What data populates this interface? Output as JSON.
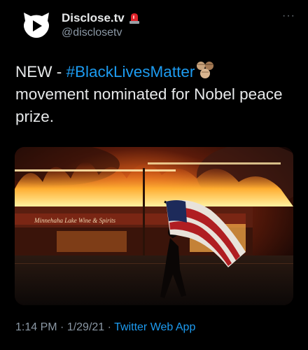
{
  "account": {
    "display_name": "Disclose.tv",
    "handle": "@disclosetv",
    "badge_icon": "siren-emoji",
    "more_icon": "more-horizontal-icon",
    "more_glyph": "···"
  },
  "tweet": {
    "text_before": "NEW - ",
    "hashtag": "#BlackLivesMatter",
    "emoji": "raised-fists-emoji",
    "text_after": "movement nominated for Nobel peace prize."
  },
  "media": {
    "storefront_sign": "Minnehaha Lake  Wine & Spirits"
  },
  "footer": {
    "time": "1:14 PM",
    "sep1": " · ",
    "date": "1/29/21",
    "sep2": " · ",
    "app": "Twitter Web App"
  },
  "colors": {
    "background": "#000000",
    "link": "#1d9bf0",
    "secondary_text": "#8b98a5"
  }
}
